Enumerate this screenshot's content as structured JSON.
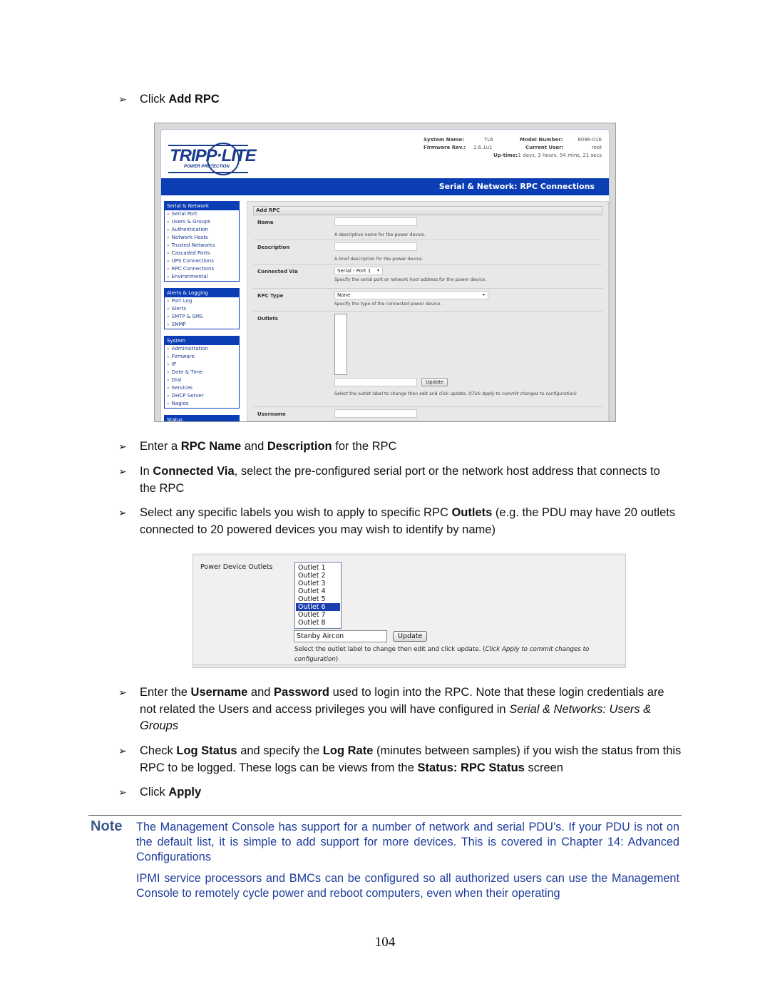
{
  "steps": {
    "s1": {
      "pre": "Click ",
      "b1": "Add RPC"
    },
    "s2": {
      "pre": "Enter a ",
      "b1": "RPC Name",
      "mid": " and ",
      "b2": "Description",
      "post": " for the RPC"
    },
    "s3": {
      "pre": "In ",
      "b1": "Connected Via",
      "post": ", select the pre-configured serial port or the network host address that connects to the RPC"
    },
    "s4": {
      "pre": "Select any specific labels you wish to apply to specific RPC ",
      "b1": "Outlets",
      "post": " (e.g. the PDU may have 20 outlets connected to 20 powered devices you may wish to identify by name)"
    },
    "s5": {
      "pre": "Enter the ",
      "b1": "Username",
      "mid": " and ",
      "b2": "Password",
      "post": " used to login into the RPC. Note that these login credentials are not related the Users and access privileges you will have configured in ",
      "i1": "Serial & Networks: Users & Groups"
    },
    "s6": {
      "pre": "Check ",
      "b1": "Log Status",
      "mid": " and specify the ",
      "b2": "Log Rate",
      "mid2": " (minutes between samples) if you wish the status from this RPC to be logged. These logs can be views from the ",
      "b3": "Status: RPC Status",
      "post": " screen"
    },
    "s7": {
      "pre": "Click ",
      "b1": "Apply"
    }
  },
  "screenshot1": {
    "brand": {
      "word": "TRIPP·LITE",
      "tagline": "POWER PROTECTION"
    },
    "sysinfo": {
      "system_name_label": "System Name:",
      "system_name": "TL6",
      "model_label": "Model Number:",
      "model": "8096-016",
      "firmware_label": "Firmware Rev.:",
      "firmware": "2.6.1u1",
      "user_label": "Current User:",
      "user": "root",
      "uptime_label": "Up-time:",
      "uptime": "1 days, 3 hours, 54 mins, 21 secs"
    },
    "page_title": "Serial & Network: RPC Connections",
    "sidebar": [
      {
        "title": "Serial & Network",
        "items": [
          "Serial Port",
          "Users & Groups",
          "Authentication",
          "Network Hosts",
          "Trusted Networks",
          "Cascaded Ports",
          "UPS Connections",
          "RPC Connections",
          "Environmental"
        ]
      },
      {
        "title": "Alerts & Logging",
        "items": [
          "Port Log",
          "Alerts",
          "SMTP & SMS",
          "SNMP"
        ]
      },
      {
        "title": "System",
        "items": [
          "Administration",
          "Firmware",
          "IP",
          "Date & Time",
          "Dial",
          "Services",
          "DHCP Server",
          "Nagios"
        ]
      },
      {
        "title": "Status",
        "items": []
      }
    ],
    "form": {
      "section_title": "Add RPC",
      "name_label": "Name",
      "name_value": "",
      "name_help": "A descriptive name for the power device.",
      "desc_label": "Description",
      "desc_value": "",
      "desc_help": "A brief description for the power device.",
      "via_label": "Connected Via",
      "via_value": "Serial - Port 1",
      "via_help": "Specify the serial port or network host address for the power device.",
      "type_label": "RPC Type",
      "type_value": "None",
      "type_help": "Specify the type of the connected power device.",
      "outlets_label": "Outlets",
      "outlet_label_value": "",
      "update_label": "Update",
      "outlets_help": "Select the outlet label to change then edit and click update. ",
      "outlets_help_italic": "(Click Apply to commit changes to configuration)",
      "username_label": "Username",
      "username_value": ""
    }
  },
  "screenshot2": {
    "label": "Power Device Outlets",
    "outlets": [
      "Outlet 1",
      "Outlet 2",
      "Outlet 3",
      "Outlet 4",
      "Outlet 5",
      "Outlet 6",
      "Outlet 7",
      "Outlet 8"
    ],
    "selected": "Outlet 6",
    "label_value": "Stanby Aircon",
    "update_label": "Update",
    "hint": "Select the outlet label to change then edit and click update. (",
    "hint_italic": "Click Apply to commit changes to configuration",
    "hint_end": ")"
  },
  "note": {
    "label": "Note",
    "p1": "The Management Console has support for a number of network and serial PDU’s. If your PDU is not on the default list, it is simple to add support for more devices. This is covered in Chapter 14: Advanced Configurations",
    "p2": "IPMI service processors and BMCs can be configured so all authorized users can use the Management Console to remotely cycle power and reboot computers, even when their operating"
  },
  "page_number": "104",
  "icons": {
    "bullet": "➢",
    "nav_marker": "»",
    "dropdown": "▾"
  }
}
